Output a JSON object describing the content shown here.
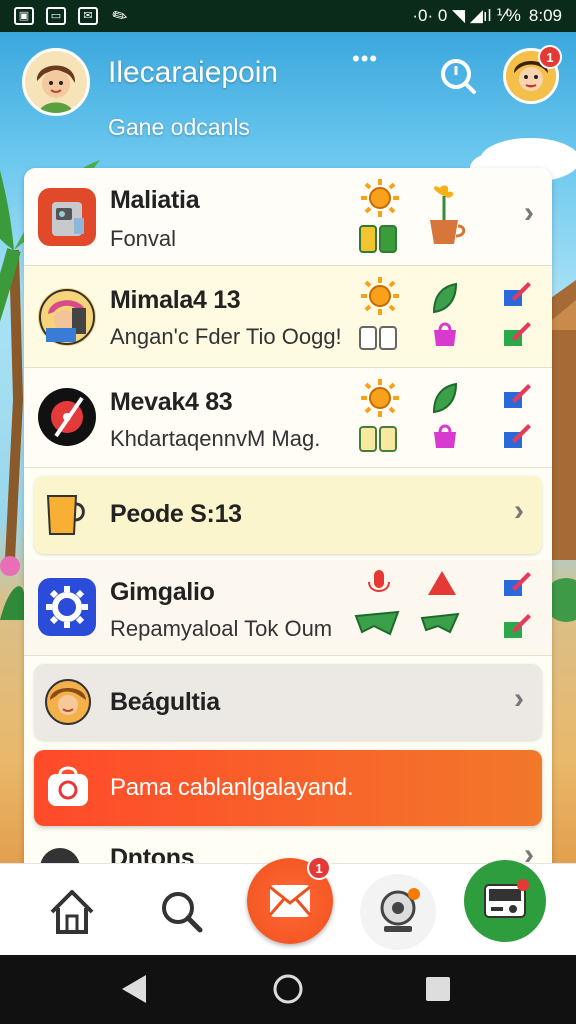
{
  "status_bar": {
    "left_icons": [
      "gallery-icon",
      "briefcase-icon",
      "mail-icon",
      "wrench-icon"
    ],
    "right_text": "·0· 0  ◥ ◢ıl ⅟% ",
    "time": "8:09"
  },
  "header": {
    "title": "Ilecaraiepoin",
    "subtitle": "Gane odcanls",
    "more": "•••",
    "badge_count": "1"
  },
  "rows": [
    {
      "title": "Maliatia",
      "subtitle": "Fonval",
      "has_chevron": true
    },
    {
      "title": "Mimala4 13",
      "subtitle": "Angan'c Fder Tio Oogg!"
    },
    {
      "title": "Mevak4 83",
      "subtitle": "KhdartaqennvM Mag."
    },
    {
      "title": "Peode S:13",
      "has_chevron": true
    },
    {
      "title": "Gimgalio",
      "subtitle": "Repamyaloal Tok Oum"
    },
    {
      "title": "Beágultia",
      "has_chevron": true
    },
    {
      "title": "Pama cablanlgalayand."
    },
    {
      "title": "Dntons"
    }
  ],
  "chevron": "›",
  "bottom_nav": {
    "mail_badge": "1"
  },
  "colors": {
    "accent_orange": "#ff4a2a",
    "header_blue": "#2f9fd9",
    "green_action": "#2e9d3e"
  }
}
